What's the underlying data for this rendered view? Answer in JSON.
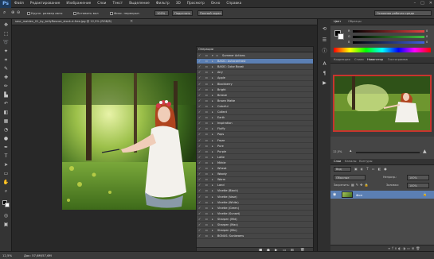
{
  "menubar": {
    "logo": "Ps",
    "items": [
      "Файл",
      "Редактирование",
      "Изображение",
      "Слои",
      "Текст",
      "Выделение",
      "Фильтр",
      "3D",
      "Просмотр",
      "Окно",
      "Справка"
    ]
  },
  "options": {
    "sample_size": "Крупн. размер авто",
    "show_all": "Вставить вкл",
    "shadow": "Фикс. перекрыт.",
    "zoom_fit": "100%",
    "fit_screen_label": "Подогнать",
    "fill_screen_label": "Полный экран",
    "workspace": "Основная рабочая среда"
  },
  "document": {
    "tab_title": "sour_maiden_01_by_kellyRoscoe_stock-d-free.jpg @ 12,5% (RGB/8)"
  },
  "actions_panel": {
    "title": "Операции",
    "items": [
      {
        "label": "Summer Actions",
        "selected": false,
        "folder": true
      },
      {
        "label": "BASIC: Autocontrast",
        "selected": true
      },
      {
        "label": "BASIC: Color Boost",
        "selected": false
      },
      {
        "label": "Airy",
        "selected": false
      },
      {
        "label": "Apple",
        "selected": false
      },
      {
        "label": "Blackberry",
        "selected": false
      },
      {
        "label": "Bright",
        "selected": false
      },
      {
        "label": "Breeze",
        "selected": false
      },
      {
        "label": "Brown Matte",
        "selected": false
      },
      {
        "label": "Colorful",
        "selected": false
      },
      {
        "label": "Collect",
        "selected": false
      },
      {
        "label": "Earth",
        "selected": false
      },
      {
        "label": "Inspiration",
        "selected": false
      },
      {
        "label": "Fluffy",
        "selected": false
      },
      {
        "label": "Pops",
        "selected": false
      },
      {
        "label": "Froze",
        "selected": false
      },
      {
        "label": "Pure",
        "selected": false
      },
      {
        "label": "Purple",
        "selected": false
      },
      {
        "label": "Latte",
        "selected": false
      },
      {
        "label": "Mirkle",
        "selected": false
      },
      {
        "label": "Wheat",
        "selected": false
      },
      {
        "label": "Woody",
        "selected": false
      },
      {
        "label": "Warm",
        "selected": false
      },
      {
        "label": "Land",
        "selected": false
      },
      {
        "label": "Vinette (Black)",
        "selected": false
      },
      {
        "label": "Vinette (Vase)",
        "selected": false
      },
      {
        "label": "Vinette (White)",
        "selected": false
      },
      {
        "label": "Vinette (Green)",
        "selected": false
      },
      {
        "label": "Vinette (Sunset)",
        "selected": false
      },
      {
        "label": "Sharpen (Mid)",
        "selected": false
      },
      {
        "label": "Sharpen (Max)",
        "selected": false
      },
      {
        "label": "Sharpen (Min)",
        "selected": false
      },
      {
        "label": "BONUS: Sunbeams",
        "selected": false
      }
    ]
  },
  "color_panel": {
    "tabs": [
      "Цвет",
      "Образцы"
    ],
    "r": 0,
    "g": 0,
    "b": 0,
    "colors": {
      "r": "#e24040",
      "g": "#40c040",
      "b": "#4060e0"
    }
  },
  "adjust_panel": {
    "tabs": [
      "Коррекция",
      "Стили",
      "Навигатор",
      "Гистограмма"
    ]
  },
  "navigator": {
    "zoom": "12,5%"
  },
  "layers_panel": {
    "tabs": [
      "Слои",
      "Каналы",
      "Контуры"
    ],
    "kind": "Вид",
    "blend_mode": "Обычные",
    "opacity_label": "Непрозр.:",
    "opacity": "100%",
    "lock_label": "Закрепить:",
    "fill_label": "Заливка:",
    "fill": "100%",
    "layers": [
      {
        "name": "Фон",
        "visible": true,
        "locked": true
      }
    ]
  },
  "status": {
    "zoom": "12,5%",
    "doc": "Док: 57,6M/57,6M"
  }
}
